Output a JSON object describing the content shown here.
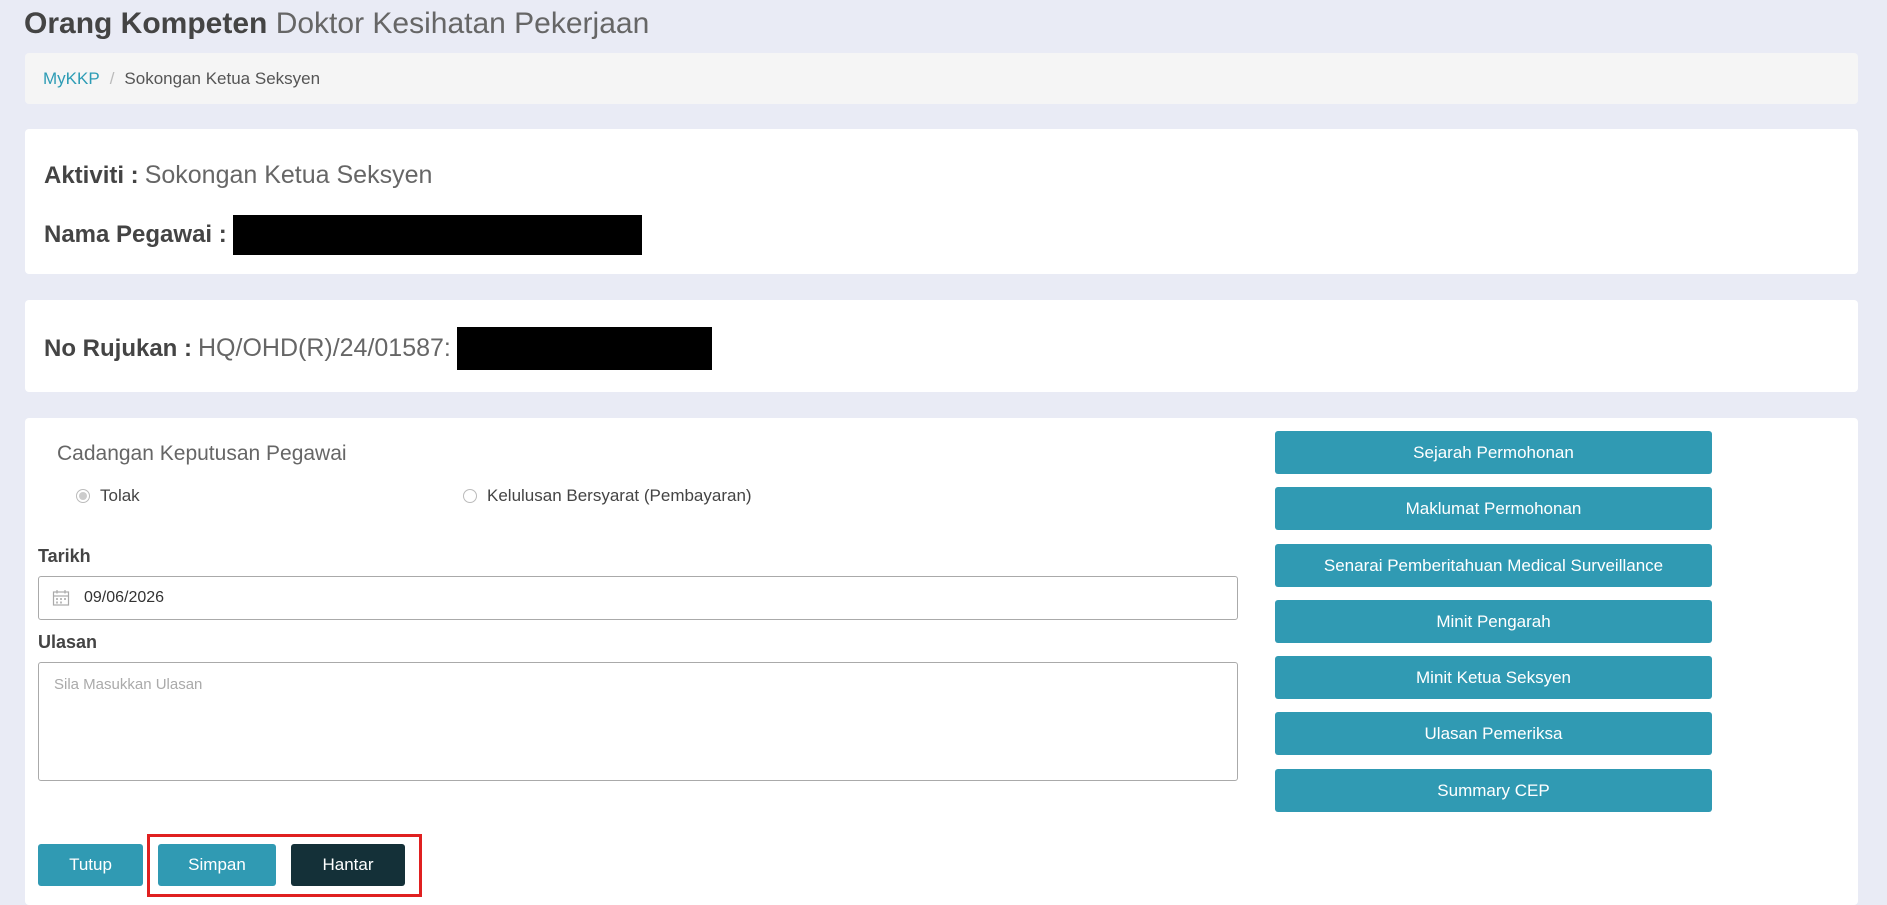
{
  "header": {
    "title_bold": "Orang Kompeten",
    "title_light": "Doktor Kesihatan Pekerjaan"
  },
  "breadcrumb": {
    "items": [
      "MyKKP",
      "Sokongan Ketua Seksyen"
    ],
    "separator": "/"
  },
  "activity": {
    "aktiviti_label": "Aktiviti :",
    "aktiviti_value": "Sokongan Ketua Seksyen",
    "nama_label": "Nama Pegawai :"
  },
  "reference": {
    "label": "No Rujukan :",
    "value": "HQ/OHD(R)/24/01587:"
  },
  "decision": {
    "heading": "Cadangan Keputusan Pegawai",
    "options": [
      "Tolak",
      "Kelulusan Bersyarat (Pembayaran)"
    ],
    "selected": "Tolak"
  },
  "form": {
    "tarikh_label": "Tarikh",
    "tarikh_value": "09/06/2026",
    "ulasan_label": "Ulasan",
    "ulasan_placeholder": "Sila Masukkan Ulasan"
  },
  "side_buttons": [
    "Sejarah Permohonan",
    "Maklumat Permohonan",
    "Senarai Pemberitahuan Medical Surveillance",
    "Minit Pengarah",
    "Minit Ketua Seksyen",
    "Ulasan Pemeriksa",
    "Summary CEP"
  ],
  "actions": {
    "tutup": "Tutup",
    "simpan": "Simpan",
    "hantar": "Hantar"
  },
  "colors": {
    "accent": "#309ab3",
    "dark_button": "#143038",
    "highlight": "#e02020",
    "background": "#e9ebf5"
  }
}
